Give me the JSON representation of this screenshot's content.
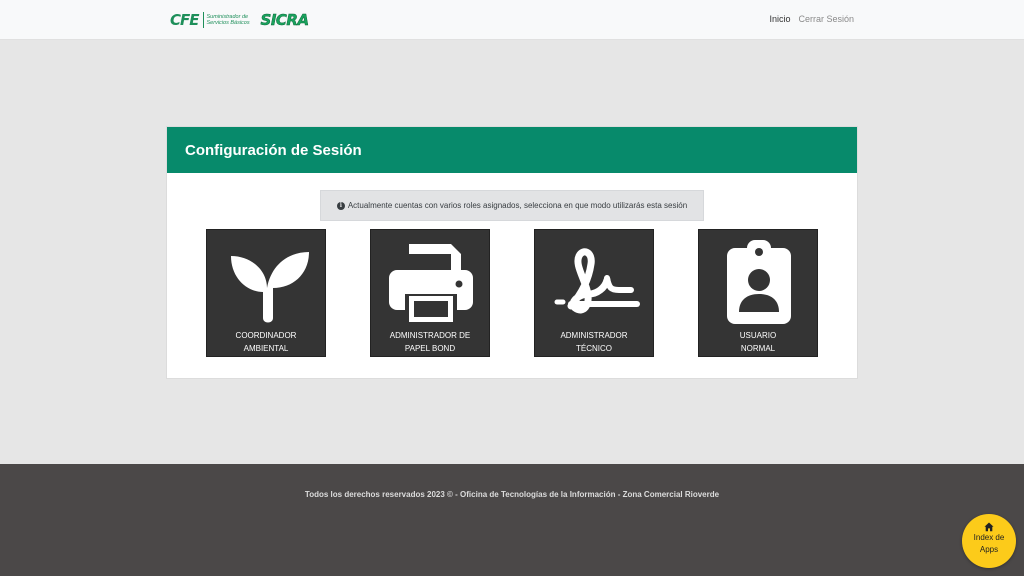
{
  "navbar": {
    "logo_cfe": "CFE",
    "logo_sub_1": "Suministrador de",
    "logo_sub_2": "Servicios Básicos",
    "logo_app": "SICRA",
    "links": [
      {
        "label": "Inicio",
        "active": true
      },
      {
        "label": "Cerrar Sesión",
        "active": false
      }
    ]
  },
  "card": {
    "title": "Configuración de Sesión",
    "alert_text": "Actualmente cuentas con varios roles asignados, selecciona en que modo utilizarás esta sesión",
    "alert_icon": "info-circle-icon"
  },
  "roles": [
    {
      "line1": "COORDINADOR",
      "line2": "AMBIENTAL",
      "icon": "seedling-icon"
    },
    {
      "line1": "ADMINISTRADOR DE",
      "line2": "PAPEL BOND",
      "icon": "printer-icon"
    },
    {
      "line1": "ADMINISTRADOR",
      "line2": "TÉCNICO",
      "icon": "signature-icon"
    },
    {
      "line1": "USUARIO",
      "line2": "NORMAL",
      "icon": "id-badge-icon"
    }
  ],
  "footer": {
    "text": "Todos los derechos reservados 2023 © - Oficina de Tecnologías de la Información - Zona Comercial Rioverde"
  },
  "fab": {
    "line1": "Index de",
    "line2": "Apps",
    "icon": "home-icon"
  },
  "colors": {
    "header_green": "#078a6b",
    "tile_dark": "#343434",
    "footer_bg": "#4b4848",
    "fab_yellow": "#fccb1a"
  }
}
